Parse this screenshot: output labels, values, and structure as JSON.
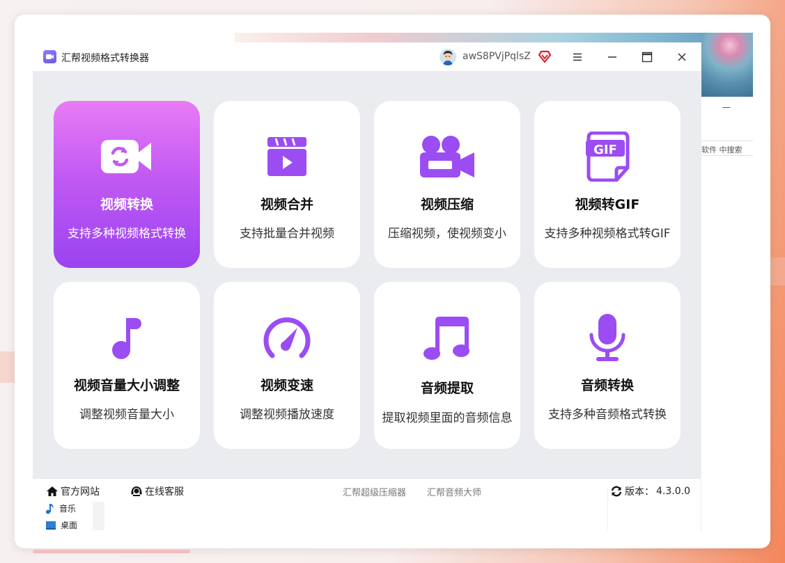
{
  "window": {
    "title": "汇帮视频格式转换器",
    "username": "awS8PVjPqlsZ"
  },
  "background": {
    "search_text": "软件 中搜索",
    "dash": "—"
  },
  "tiles": [
    {
      "title": "视频转换",
      "desc": "支持多种视频格式转换",
      "icon": "video-convert-icon",
      "active": true
    },
    {
      "title": "视频合并",
      "desc": "支持批量合并视频",
      "icon": "clapperboard-icon",
      "active": false
    },
    {
      "title": "视频压缩",
      "desc": "压缩视频，使视频变小",
      "icon": "video-camera-icon",
      "active": false
    },
    {
      "title": "视频转GIF",
      "desc": "支持多种视频格式转GIF",
      "icon": "gif-file-icon",
      "active": false
    },
    {
      "title": "视频音量大小调整",
      "desc": "调整视频音量大小",
      "icon": "music-note-icon",
      "active": false
    },
    {
      "title": "视频变速",
      "desc": "调整视频播放速度",
      "icon": "speedometer-icon",
      "active": false
    },
    {
      "title": "音频提取",
      "desc": "提取视频里面的音频信息",
      "icon": "double-music-note-icon",
      "active": false
    },
    {
      "title": "音频转换",
      "desc": "支持多种音频格式转换",
      "icon": "microphone-icon",
      "active": false
    }
  ],
  "footer": {
    "website": "官方网站",
    "support": "在线客服",
    "compressor": "汇帮超级压缩器",
    "audio_master": "汇帮音频大师",
    "version_label": "版本：",
    "version": "4.3.0.0"
  },
  "tree": {
    "music": "音乐",
    "desktop": "桌面"
  },
  "colors": {
    "accent": "#9b4cf3",
    "active_tile_top": "#e87cf4",
    "active_tile_bottom": "#9a43f0",
    "app_bg": "#ebecf0"
  }
}
